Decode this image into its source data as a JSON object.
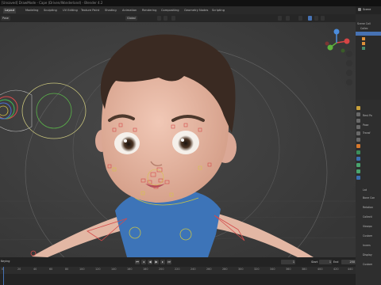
{
  "window": {
    "title": "[Unsaved] DrawMode - Cape (Driven/Wonderland) - Blender 4.2"
  },
  "workspace_tabs": [
    "Layout",
    "Modeling",
    "Sculpting",
    "UV Editing",
    "Texture Paint",
    "Shading",
    "Animation",
    "Rendering",
    "Compositing",
    "Geometry Nodes",
    "Scripting"
  ],
  "active_tab": "Layout",
  "viewport_header": {
    "mode": "Pose",
    "select": "Select Box",
    "transform": "Global",
    "pose_options": "Pose Options"
  },
  "outliner": {
    "scene_label": "Scene",
    "rows": [
      "Scene Coll",
      "Collec",
      "",
      "",
      ""
    ]
  },
  "properties": {
    "rows": [
      "Rest Po",
      "Pose",
      "Transf",
      "",
      "Lat",
      "Bone Con",
      "Relation",
      "Collecti",
      "Viewpo",
      "Custom",
      "Invers",
      "Display",
      "Custom"
    ]
  },
  "timeline": {
    "ticks": [
      "0",
      "20",
      "40",
      "60",
      "80",
      "100",
      "120",
      "140",
      "160",
      "180",
      "200",
      "220",
      "240",
      "260",
      "280",
      "300",
      "320",
      "340",
      "360",
      "380",
      "400",
      "420",
      "440"
    ],
    "current_frame": "1",
    "start_label": "Start",
    "start_value": "1",
    "end_label": "End",
    "end_value": "250",
    "keying_label": "Keying"
  },
  "colors": {
    "viewport_bg": "#3b3b3b",
    "accent": "#4772b3",
    "shirt": "#3d74b8",
    "skin": "#e0b3a1",
    "hair": "#3a2a22"
  }
}
